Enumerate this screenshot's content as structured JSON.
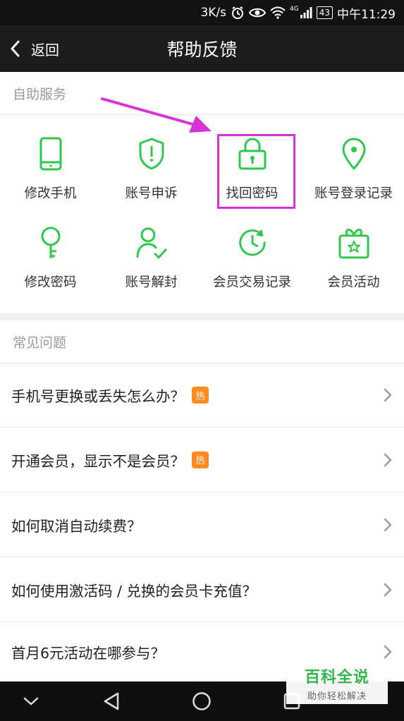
{
  "status_bar": {
    "speed": "3K/s",
    "battery": "43",
    "time": "中午11:29",
    "network": "4G"
  },
  "nav": {
    "back_label": "返回",
    "title": "帮助反馈"
  },
  "self_service": {
    "header": "自助服务",
    "items": [
      {
        "label": "修改手机",
        "icon": "phone-icon"
      },
      {
        "label": "账号申诉",
        "icon": "shield-icon"
      },
      {
        "label": "找回密码",
        "icon": "lock-icon"
      },
      {
        "label": "账号登录记录",
        "icon": "location-pin-icon"
      },
      {
        "label": "修改密码",
        "icon": "key-icon"
      },
      {
        "label": "账号解封",
        "icon": "user-check-icon"
      },
      {
        "label": "会员交易记录",
        "icon": "clock-refresh-icon"
      },
      {
        "label": "会员活动",
        "icon": "gift-icon"
      }
    ]
  },
  "faq": {
    "header": "常见问题",
    "hot_badge": "热",
    "items": [
      {
        "label": "手机号更换或丢失怎么办？",
        "hot": true
      },
      {
        "label": "开通会员，显示不是会员？",
        "hot": true
      },
      {
        "label": "如何取消自动续费？",
        "hot": false
      },
      {
        "label": "如何使用激活码 / 兑换的会员卡充值？",
        "hot": false
      },
      {
        "label": "首月6元活动在哪参与？",
        "hot": false
      }
    ]
  },
  "watermark": {
    "title": "百科全说",
    "subtitle": "助你轻松解决"
  },
  "colors": {
    "accent_green": "#2ec84a",
    "highlight": "#d633d6",
    "hot_orange": "#ff8a1f"
  }
}
